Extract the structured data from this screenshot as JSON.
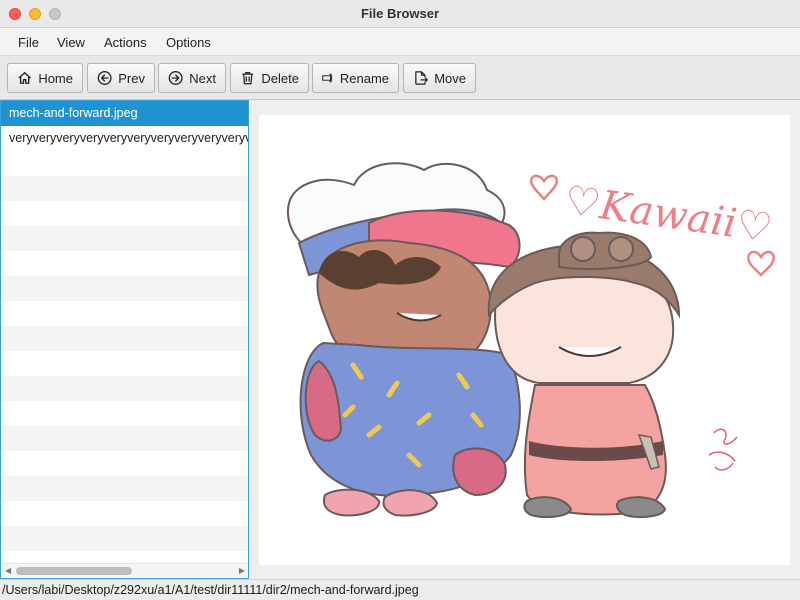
{
  "window": {
    "title": "File Browser"
  },
  "menu": {
    "items": [
      "File",
      "View",
      "Actions",
      "Options"
    ]
  },
  "toolbar": {
    "home_label": "Home",
    "prev_label": "Prev",
    "next_label": "Next",
    "delete_label": "Delete",
    "rename_label": "Rename",
    "move_label": "Move"
  },
  "files": {
    "items": [
      {
        "name": "mech-and-forward.jpeg",
        "selected": true
      },
      {
        "name": "veryveryveryveryveryveryveryveryveryveryveryveryvery",
        "selected": false
      }
    ]
  },
  "preview": {
    "image_text": "♡Kawaii♡"
  },
  "status": {
    "path": "/Users/labi/Desktop/z292xu/a1/A1/test/dir11111/dir2/mech-and-forward.jpeg"
  },
  "colors": {
    "selection": "#1f93d1",
    "focus_border": "#3b9fd8"
  }
}
